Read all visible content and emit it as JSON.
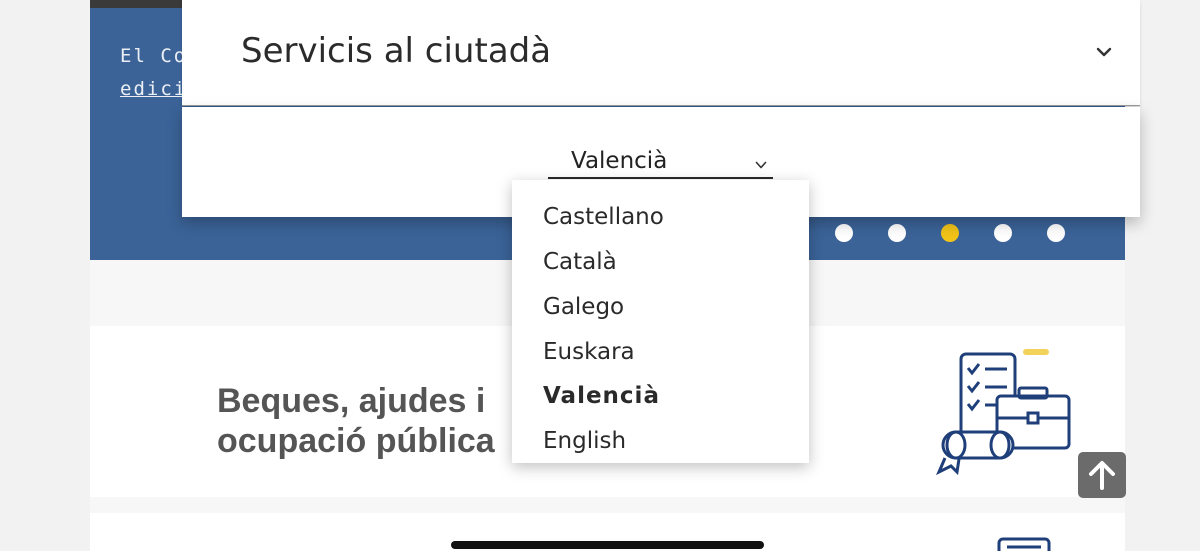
{
  "hero": {
    "text_line1": "El Co",
    "text_line2": "edici"
  },
  "accordion": {
    "title": "Servicis al ciutadà"
  },
  "language_select": {
    "selected": "Valencià",
    "options": [
      "Castellano",
      "Català",
      "Galego",
      "Euskara",
      "Valencià",
      "English"
    ],
    "selected_index": 4
  },
  "carousel": {
    "dot_count": 5,
    "active_index": 2
  },
  "cards": [
    {
      "title_line1": "Beques, ajudes i",
      "title_line2": "ocupació pública"
    }
  ],
  "colors": {
    "brand_blue": "#3b6398",
    "accent_yellow": "#f2c318",
    "icon_navy": "#1f3f7a"
  }
}
